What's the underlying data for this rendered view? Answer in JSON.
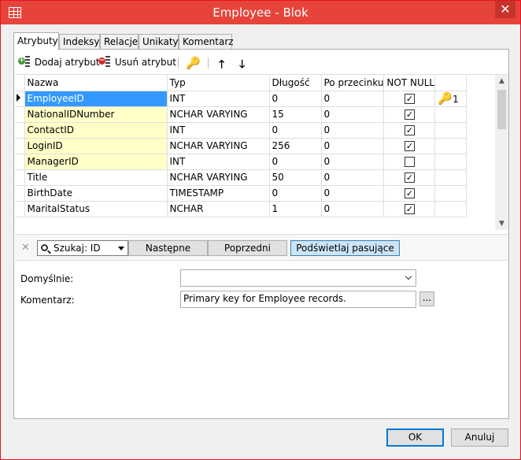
{
  "window": {
    "title": "Employee - Blok",
    "close_glyph": "✕"
  },
  "tabs": [
    {
      "label": "Atrybuty",
      "active": true
    },
    {
      "label": "Indeksy"
    },
    {
      "label": "Relacje"
    },
    {
      "label": "Unikaty"
    },
    {
      "label": "Komentarz"
    }
  ],
  "toolbar": {
    "add_label": "Dodaj atrybut",
    "remove_label": "Usuń atrybut",
    "key_glyph": "🔑",
    "up_glyph": "🡑",
    "down_glyph": "🡓"
  },
  "grid": {
    "columns": [
      "Nazwa",
      "Typ",
      "Długość",
      "Po przecinku",
      "NOT NULL",
      ""
    ],
    "rows": [
      {
        "name": "EmployeeID",
        "type": "INT",
        "length": "0",
        "scale": "0",
        "not_null": true,
        "pk": "1"
      },
      {
        "name": "NationalIDNumber",
        "type": "NCHAR VARYING",
        "length": "15",
        "scale": "0",
        "not_null": true
      },
      {
        "name": "ContactID",
        "type": "INT",
        "length": "0",
        "scale": "0",
        "not_null": true
      },
      {
        "name": "LoginID",
        "type": "NCHAR VARYING",
        "length": "256",
        "scale": "0",
        "not_null": true
      },
      {
        "name": "ManagerID",
        "type": "INT",
        "length": "0",
        "scale": "0",
        "not_null": false
      },
      {
        "name": "Title",
        "type": "NCHAR VARYING",
        "length": "50",
        "scale": "0",
        "not_null": true
      },
      {
        "name": "BirthDate",
        "type": "TIMESTAMP",
        "length": "0",
        "scale": "0",
        "not_null": true
      },
      {
        "name": "MaritalStatus",
        "type": "NCHAR",
        "length": "1",
        "scale": "0",
        "not_null": true
      }
    ],
    "check_glyph": "✓",
    "pk_glyph": "🔑"
  },
  "search": {
    "close_glyph": "✕",
    "combo_value": "Szukaj: ID",
    "next_label": "Następne",
    "prev_label": "Poprzedni",
    "highlight_label": "Podświetlaj pasujące"
  },
  "form": {
    "default_label": "Domyślnie:",
    "default_value": "",
    "comment_label": "Komentarz:",
    "comment_value": "Primary key for Employee records.",
    "dots_label": "..."
  },
  "footer": {
    "ok_label": "OK",
    "cancel_label": "Anuluj"
  },
  "colors": {
    "titlebar": "#e6443a",
    "selection": "#3399ff",
    "pk_cell": "#ffffc8"
  }
}
